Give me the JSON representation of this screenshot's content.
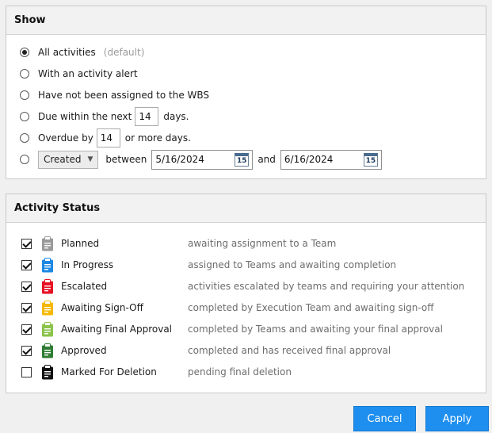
{
  "show": {
    "title": "Show",
    "options": [
      {
        "label": "All activities",
        "hint": "(default)",
        "selected": true
      },
      {
        "label": "With an activity alert",
        "selected": false
      },
      {
        "label": "Have not been assigned to the WBS",
        "selected": false
      },
      {
        "label": "Due within the next",
        "suffix": "days.",
        "value": "14",
        "selected": false
      },
      {
        "label": "Overdue by",
        "suffix": "or more days.",
        "value": "14",
        "selected": false
      },
      {
        "dropdown": "Created",
        "between": "between",
        "start_date": "5/16/2024",
        "and": "and",
        "end_date": "6/16/2024",
        "calendar_day": "15",
        "selected": false
      }
    ]
  },
  "status": {
    "title": "Activity Status",
    "items": [
      {
        "label": "Planned",
        "desc": "awaiting assignment to a Team",
        "checked": true,
        "color": "#9a9a9a"
      },
      {
        "label": "In Progress",
        "desc": "assigned to Teams and awaiting completion",
        "checked": true,
        "color": "#1e88e5"
      },
      {
        "label": "Escalated",
        "desc": "activities escalated by teams and requiring your attention",
        "checked": true,
        "color": "#e81123"
      },
      {
        "label": "Awaiting Sign-Off",
        "desc": "completed by Execution Team and awaiting sign-off",
        "checked": true,
        "color": "#f5b800"
      },
      {
        "label": "Awaiting Final Approval",
        "desc": "completed by Teams and awaiting your final approval",
        "checked": true,
        "color": "#8bc34a"
      },
      {
        "label": "Approved",
        "desc": "completed and has received final approval",
        "checked": true,
        "color": "#2e7d32"
      },
      {
        "label": "Marked For Deletion",
        "desc": "pending final deletion",
        "checked": false,
        "color": "#111111"
      }
    ]
  },
  "buttons": {
    "cancel": "Cancel",
    "apply": "Apply"
  },
  "colors": {
    "accent": "#1e8fef"
  }
}
